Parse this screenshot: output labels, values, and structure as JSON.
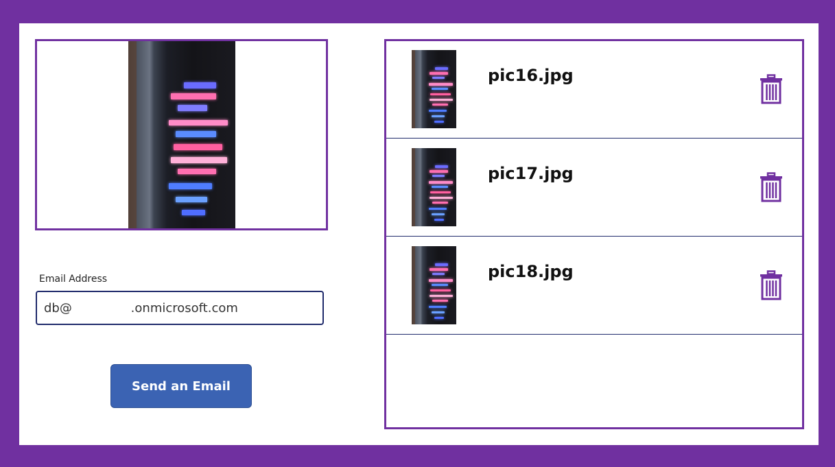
{
  "preview": {
    "image_alt": "Tablet photo with neon skyline"
  },
  "email": {
    "label": "Email Address",
    "value": "db@               .onmicrosoft.com"
  },
  "send_button": {
    "label": "Send an Email"
  },
  "gallery": {
    "items": [
      {
        "file_name": "pic16.jpg",
        "icon": "trash-icon"
      },
      {
        "file_name": "pic17.jpg",
        "icon": "trash-icon"
      },
      {
        "file_name": "pic18.jpg",
        "icon": "trash-icon"
      }
    ]
  },
  "colors": {
    "frame": "#7030a0",
    "button": "#3b63b3",
    "input_border": "#1f2a6b",
    "trash": "#7030a0"
  }
}
